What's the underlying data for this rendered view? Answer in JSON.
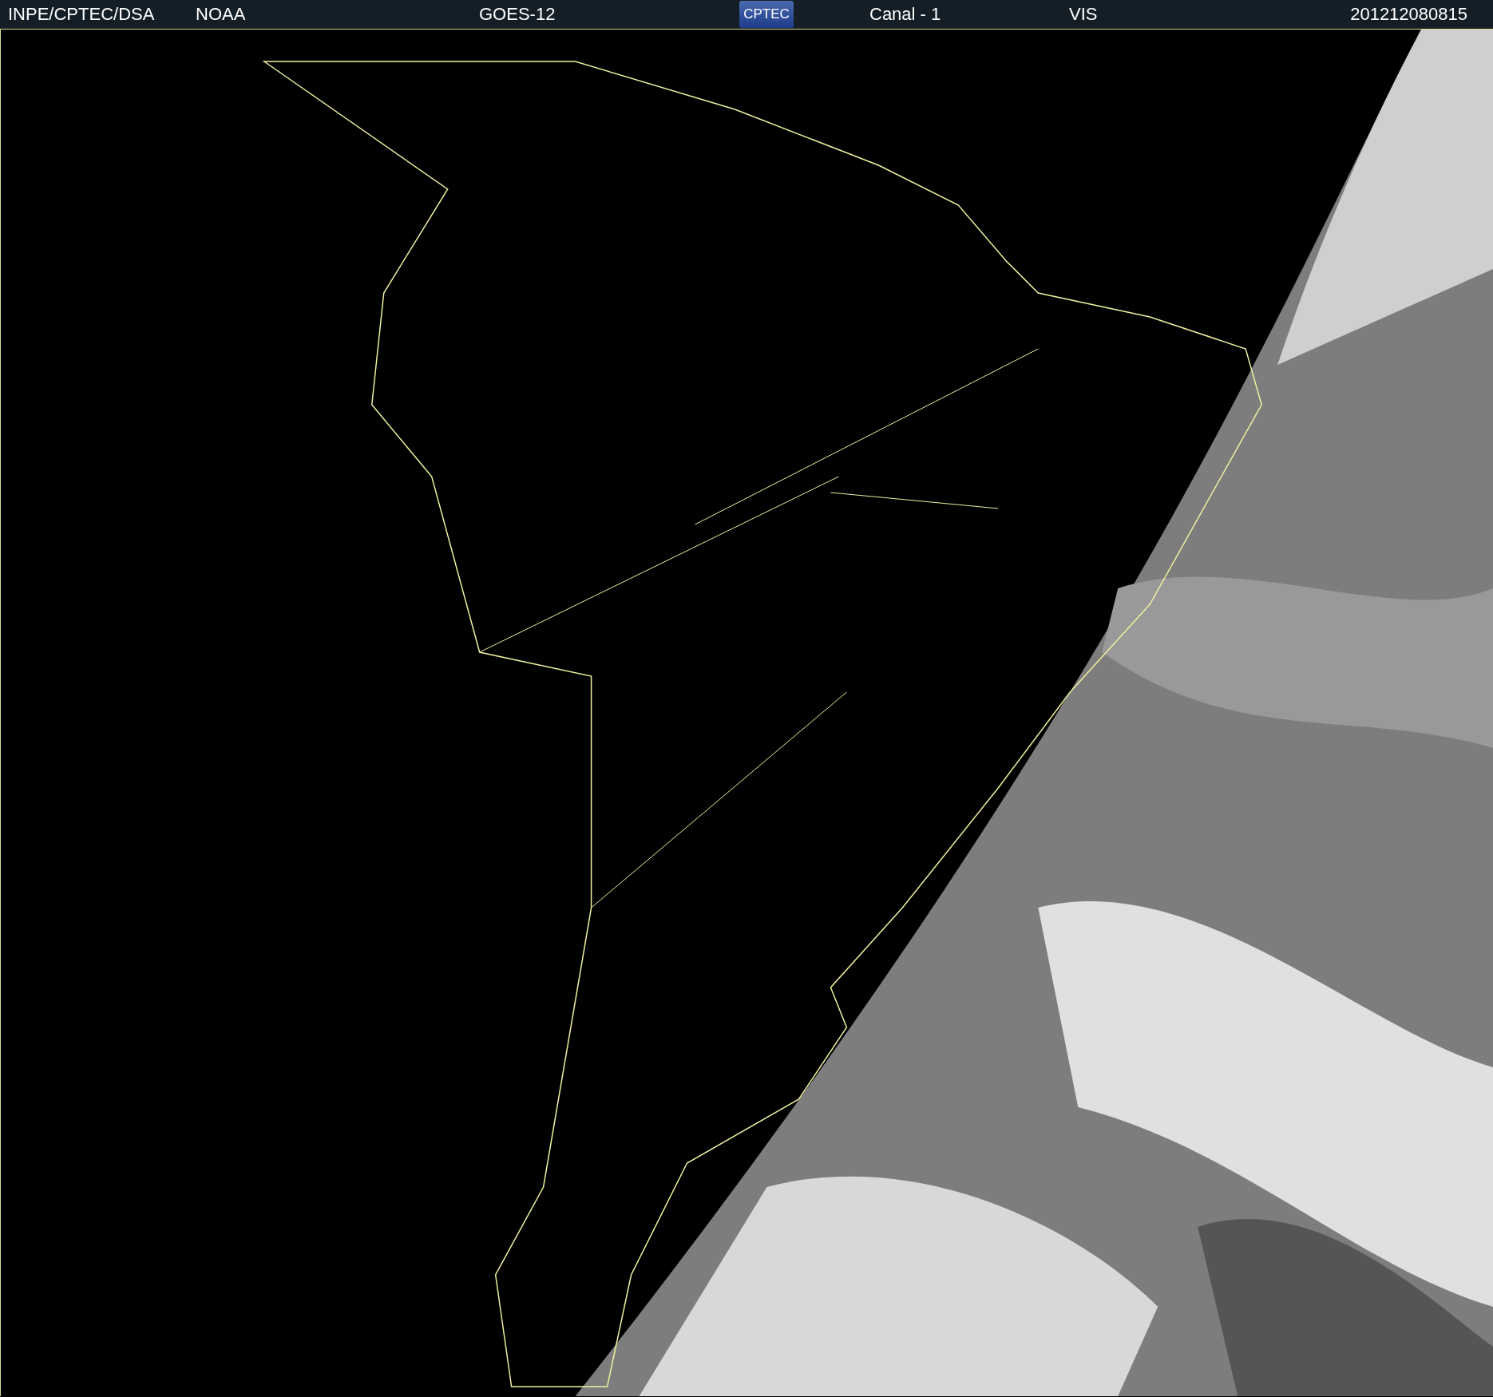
{
  "header": {
    "source": "INPE/CPTEC/DSA",
    "agency": "NOAA",
    "satellite": "GOES-12",
    "logo": "CPTEC",
    "channel": "Canal - 1",
    "band": "VIS",
    "timestamp": "201212080815"
  }
}
